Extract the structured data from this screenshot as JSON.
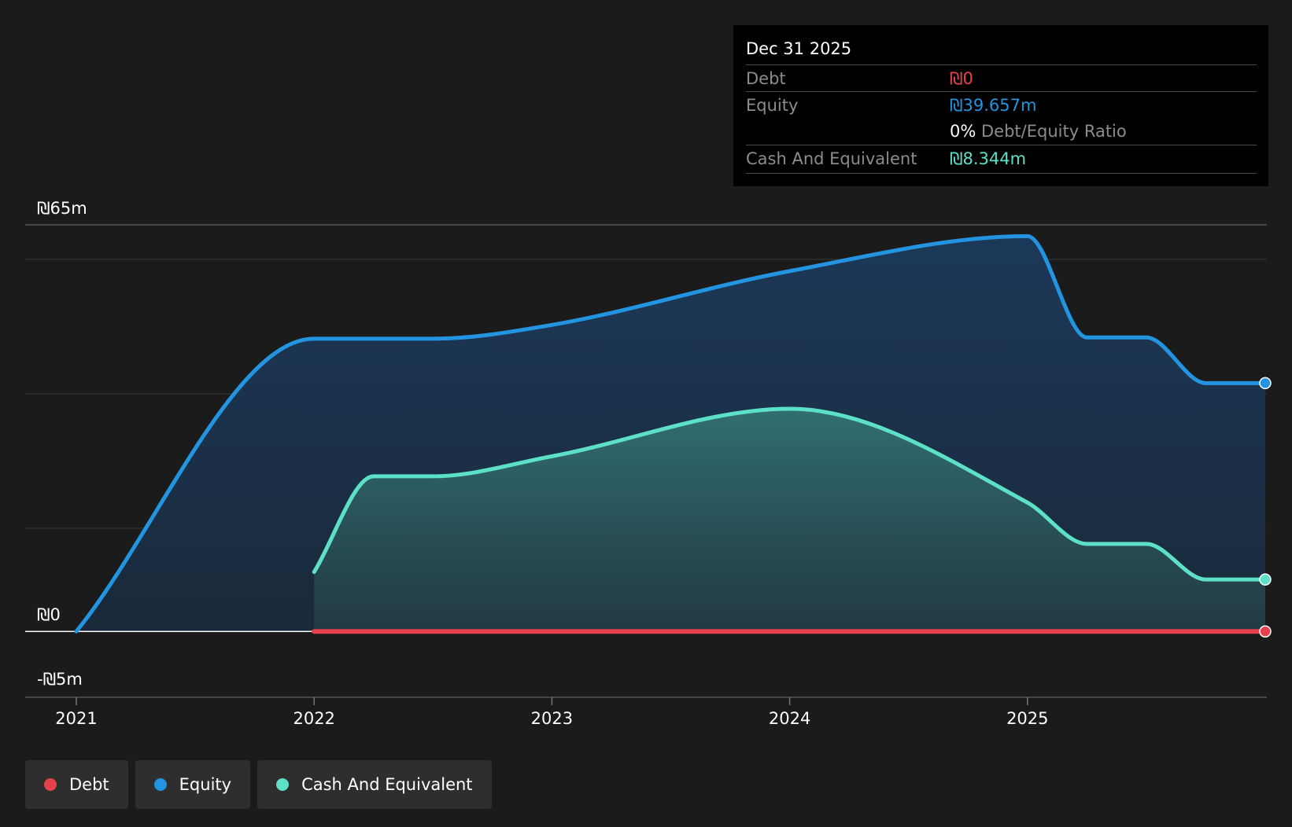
{
  "tooltip": {
    "date": "Dec 31 2025",
    "debt_label": "Debt",
    "debt_value": "₪0",
    "equity_label": "Equity",
    "equity_value": "₪39.657m",
    "ratio_value": "0%",
    "ratio_label": "Debt/Equity Ratio",
    "cash_label": "Cash And Equivalent",
    "cash_value": "₪8.344m"
  },
  "legend": [
    {
      "label": "Debt",
      "color": "#e5414a"
    },
    {
      "label": "Equity",
      "color": "#2394df"
    },
    {
      "label": "Cash And Equivalent",
      "color": "#5de0c8"
    }
  ],
  "chart_data": {
    "type": "area",
    "x_tick_labels": [
      "2021",
      "2022",
      "2023",
      "2024",
      "2025"
    ],
    "y_tick_labels": [
      "₪65m",
      "₪0",
      "-₪5m"
    ],
    "ylim": [
      -5,
      65
    ],
    "xlim": [
      2021.0,
      2026.0
    ],
    "grid": true,
    "legend_position": "bottom-left",
    "series": [
      {
        "name": "Debt",
        "color": "#e5414a",
        "x": [
          2022.0,
          2026.0
        ],
        "y": [
          0,
          0
        ]
      },
      {
        "name": "Equity",
        "color": "#2394df",
        "x": [
          2021.0,
          2022.0,
          2022.5,
          2023.0,
          2024.0,
          2025.0,
          2025.25,
          2025.5,
          2025.75,
          2026.0
        ],
        "y": [
          0,
          46.8,
          46.8,
          49.0,
          57.6,
          63.2,
          47.0,
          47.0,
          39.7,
          39.7
        ]
      },
      {
        "name": "Cash And Equivalent",
        "color": "#5de0c8",
        "x": [
          2022.0,
          2022.25,
          2022.5,
          2023.0,
          2024.0,
          2025.0,
          2025.25,
          2025.5,
          2025.75,
          2026.0
        ],
        "y": [
          9.5,
          24.8,
          24.8,
          28.0,
          35.6,
          20.6,
          14.0,
          14.0,
          8.3,
          8.3
        ]
      }
    ]
  }
}
